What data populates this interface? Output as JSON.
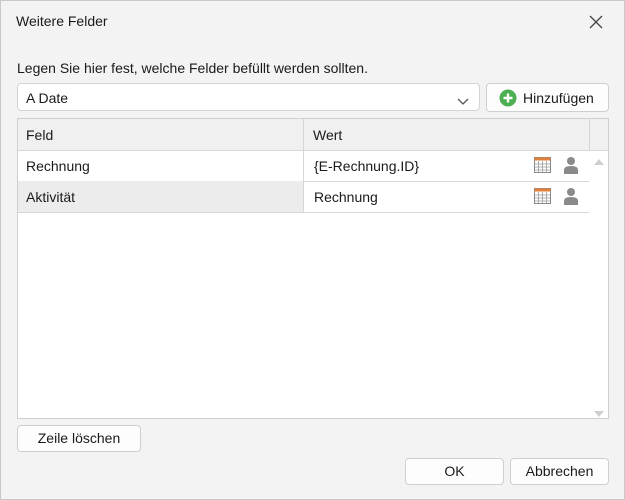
{
  "dialog": {
    "title": "Weitere Felder",
    "instruction": "Legen Sie hier fest, welche Felder befüllt werden sollten."
  },
  "field_select": {
    "selected": "A Date"
  },
  "add_button": {
    "label": "Hinzufügen"
  },
  "table": {
    "columns": [
      "Feld",
      "Wert"
    ],
    "rows": [
      {
        "feld": "Rechnung",
        "wert": "{E-Rechnung.ID}"
      },
      {
        "feld": "Aktivität",
        "wert": "Rechnung"
      }
    ]
  },
  "buttons": {
    "delete_row": "Zeile löschen",
    "ok": "OK",
    "cancel": "Abbrechen"
  },
  "colors": {
    "accent_green": "#4caf50",
    "icon_gray": "#8a8a8a"
  }
}
